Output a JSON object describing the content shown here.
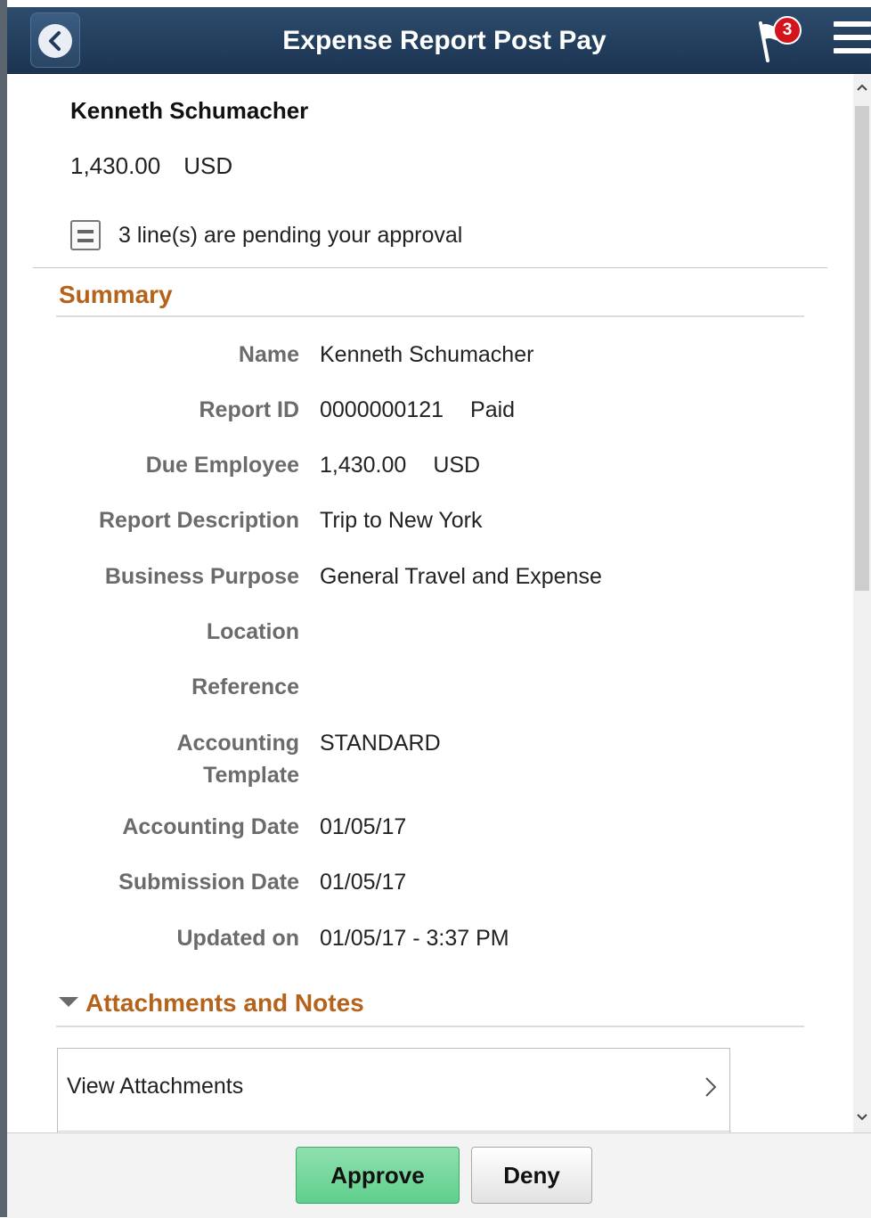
{
  "header": {
    "title": "Expense Report Post Pay",
    "notification_count": "3"
  },
  "summary_top": {
    "employee_name": "Kenneth Schumacher",
    "amount": "1,430.00",
    "currency": "USD",
    "pending_text": "3 line(s) are pending your approval"
  },
  "summary": {
    "title": "Summary",
    "fields": [
      {
        "label": "Name",
        "value": "Kenneth Schumacher"
      },
      {
        "label": "Report ID",
        "value": "0000000121",
        "status": "Paid"
      },
      {
        "label": "Due Employee",
        "value": "1,430.00",
        "currency": "USD"
      },
      {
        "label": "Report Description",
        "value": "Trip to New York"
      },
      {
        "label": "Business Purpose",
        "value": "General Travel and Expense"
      },
      {
        "label": "Location",
        "value": ""
      },
      {
        "label": "Reference",
        "value": ""
      },
      {
        "label": "Accounting Template",
        "label_line1": "Accounting",
        "label_line2": "Template",
        "value": "STANDARD"
      },
      {
        "label": "Accounting Date",
        "value": "01/05/17"
      },
      {
        "label": "Submission Date",
        "value": "01/05/17"
      },
      {
        "label": "Updated on",
        "value": "01/05/17 - 3:37 PM"
      }
    ]
  },
  "attachments": {
    "title": "Attachments and Notes",
    "view_label": "View Attachments"
  },
  "footer": {
    "approve_label": "Approve",
    "deny_label": "Deny"
  },
  "colors": {
    "header_bg": "#1f3a5a",
    "section_title": "#b5621b",
    "approve_bg": "#6dd597"
  },
  "icons": {
    "back": "chevron-left-icon",
    "flag": "flag-icon",
    "menu": "hamburger-menu-icon",
    "pending": "list-icon",
    "expand": "triangle-down-icon",
    "view": "chevron-right-icon"
  }
}
